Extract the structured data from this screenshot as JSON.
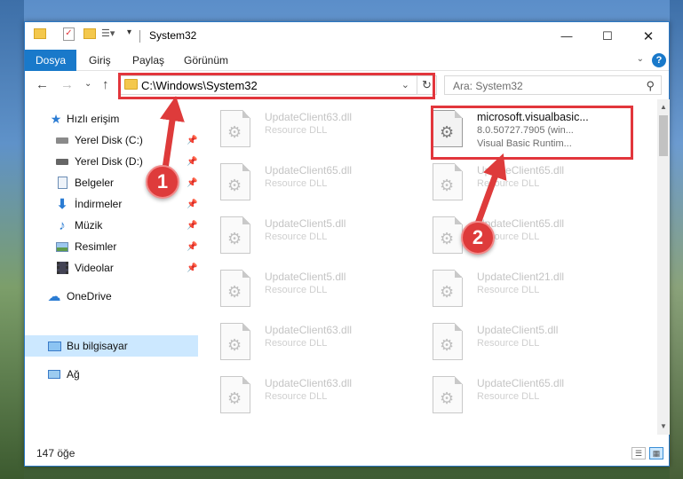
{
  "window": {
    "title": "System32"
  },
  "ribbon": {
    "tabs": [
      "Dosya",
      "Giriş",
      "Paylaş",
      "Görünüm"
    ],
    "help_label": "?"
  },
  "nav": {
    "address_path": "C:\\Windows\\System32",
    "search_placeholder": "Ara: System32"
  },
  "sidebar": {
    "items": [
      {
        "label": "Hızlı erişim",
        "icon": "star-icon",
        "pinned": false
      },
      {
        "label": "Yerel Disk (C:)",
        "icon": "drive-icon",
        "pinned": true
      },
      {
        "label": "Yerel Disk (D:)",
        "icon": "drive-icon",
        "pinned": true
      },
      {
        "label": "Belgeler",
        "icon": "documents-icon",
        "pinned": true
      },
      {
        "label": "İndirmeler",
        "icon": "download-icon",
        "pinned": true
      },
      {
        "label": "Müzik",
        "icon": "music-icon",
        "pinned": true
      },
      {
        "label": "Resimler",
        "icon": "pictures-icon",
        "pinned": true
      },
      {
        "label": "Videolar",
        "icon": "videos-icon",
        "pinned": true
      },
      {
        "label": "OneDrive",
        "icon": "cloud-icon",
        "pinned": false
      },
      {
        "label": "Bu bilgisayar",
        "icon": "computer-icon",
        "pinned": false,
        "selected": true
      },
      {
        "label": "Ağ",
        "icon": "network-icon",
        "pinned": false
      }
    ]
  },
  "files": {
    "left": [
      {
        "name": "UpdateClient63.dll",
        "type": "Resource DLL"
      },
      {
        "name": "UpdateClient65.dll",
        "type": "Resource DLL"
      },
      {
        "name": "UpdateClient5.dll",
        "type": "Resource DLL"
      },
      {
        "name": "UpdateClient5.dll",
        "type": "Resource DLL"
      },
      {
        "name": "UpdateClient63.dll",
        "type": "Resource DLL"
      },
      {
        "name": "UpdateClient63.dll",
        "type": "Resource DLL"
      }
    ],
    "right": [
      {
        "name": "microsoft.visualbasic...",
        "type": "8.0.50727.7905 (win...",
        "desc": "Visual Basic Runtim..."
      },
      {
        "name": "UpdateClient65.dll",
        "type": "Resource DLL"
      },
      {
        "name": "UpdateClient65.dll",
        "type": "Resource DLL"
      },
      {
        "name": "UpdateClient21.dll",
        "type": "Resource DLL"
      },
      {
        "name": "UpdateClient5.dll",
        "type": "Resource DLL"
      },
      {
        "name": "UpdateClient65.dll",
        "type": "Resource DLL"
      }
    ]
  },
  "status": {
    "item_count": "147 öğe"
  },
  "annotations": {
    "badge1": "1",
    "badge2": "2",
    "color": "#e2363c"
  }
}
